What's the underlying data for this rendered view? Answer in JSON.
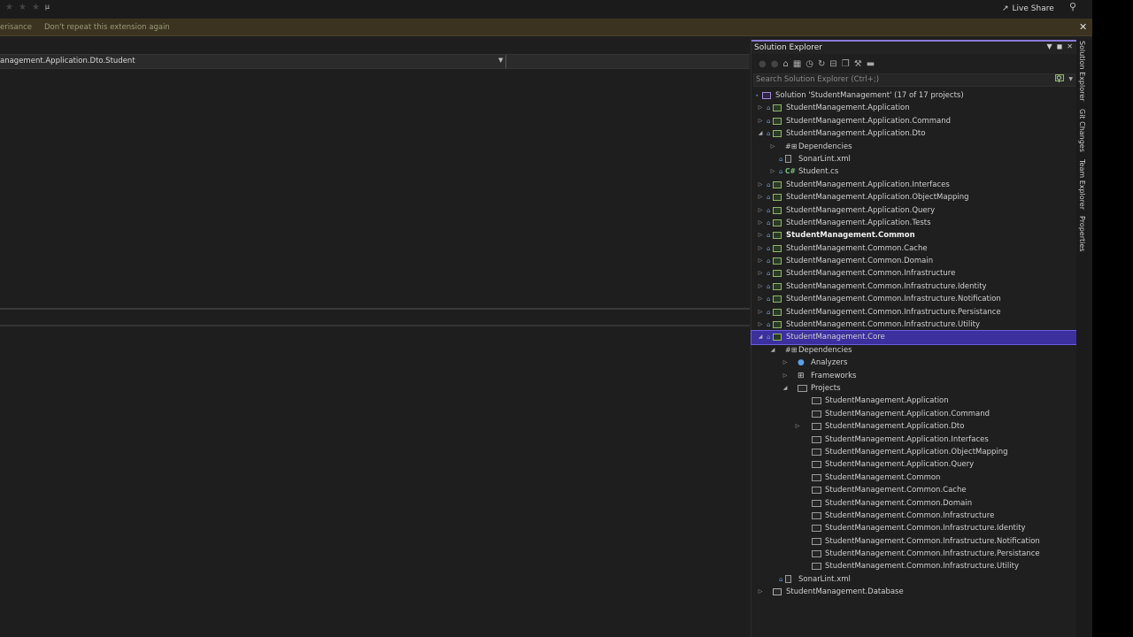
{
  "titlebar": {
    "live_share": "Live Share",
    "misc_glyph": "µ"
  },
  "infobar": {
    "link_left": "erisance",
    "link_dont_repeat": "Don't repeat this extension again"
  },
  "editor": {
    "nav_path": "anagement.Application.Dto.Student"
  },
  "solution_explorer": {
    "title": "Solution Explorer",
    "search_placeholder": "Search Solution Explorer (Ctrl+;)",
    "solution_label": "Solution 'StudentManagement' (17 of 17 projects)",
    "items": [
      "StudentManagement.Application",
      "StudentManagement.Application.Command",
      "StudentManagement.Application.Dto",
      "Dependencies",
      "SonarLint.xml",
      "Student.cs",
      "StudentManagement.Application.Interfaces",
      "StudentManagement.Application.ObjectMapping",
      "StudentManagement.Application.Query",
      "StudentManagement.Application.Tests",
      "StudentManagement.Common",
      "StudentManagement.Common.Cache",
      "StudentManagement.Common.Domain",
      "StudentManagement.Common.Infrastructure",
      "StudentManagement.Common.Infrastructure.Identity",
      "StudentManagement.Common.Infrastructure.Notification",
      "StudentManagement.Common.Infrastructure.Persistance",
      "StudentManagement.Common.Infrastructure.Utility",
      "StudentManagement.Core",
      "Dependencies",
      "Analyzers",
      "Frameworks",
      "Projects",
      "StudentManagement.Application",
      "StudentManagement.Application.Command",
      "StudentManagement.Application.Dto",
      "StudentManagement.Application.Interfaces",
      "StudentManagement.Application.ObjectMapping",
      "StudentManagement.Application.Query",
      "StudentManagement.Common",
      "StudentManagement.Common.Cache",
      "StudentManagement.Common.Domain",
      "StudentManagement.Common.Infrastructure",
      "StudentManagement.Common.Infrastructure.Identity",
      "StudentManagement.Common.Infrastructure.Notification",
      "StudentManagement.Common.Infrastructure.Persistance",
      "StudentManagement.Common.Infrastructure.Utility",
      "SonarLint.xml",
      "StudentManagement.Database"
    ]
  },
  "side_tabs": [
    "Solution Explorer",
    "Git Changes",
    "Team Explorer",
    "Properties"
  ],
  "colors": {
    "selection": "#3c2f9e",
    "accent": "#8b7bd8",
    "infobar": "#3b3320"
  }
}
